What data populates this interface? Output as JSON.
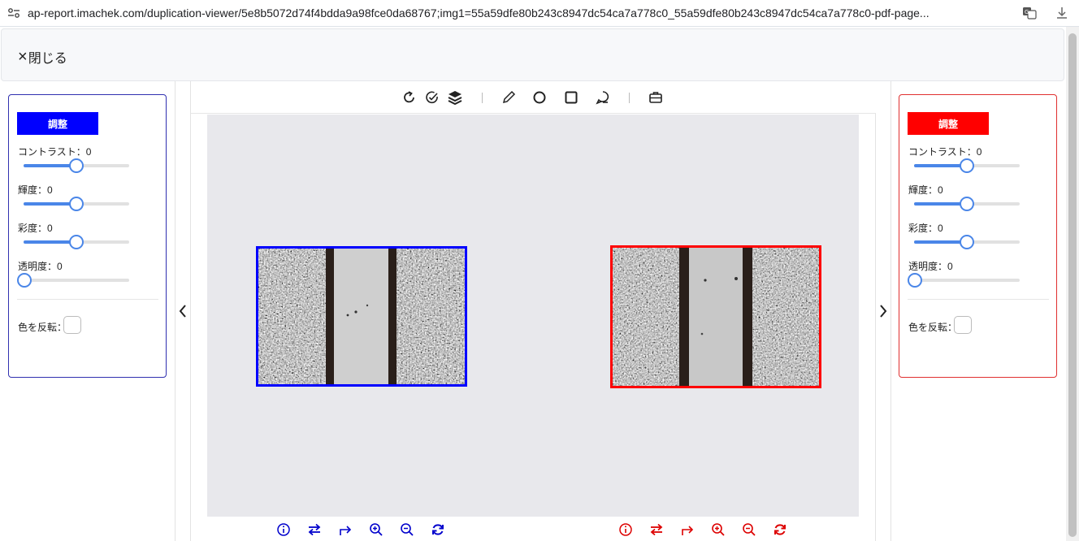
{
  "browser": {
    "url": "ap-report.imachek.com/duplication-viewer/5e8b5072d74f4bdda9a98fce0da68767;img1=55a59dfe80b243c8947dc54ca7a778c0_55a59dfe80b243c8947dc54ca7a778c0-pdf-page..."
  },
  "header": {
    "close_label": "閉じる",
    "close_icon": "×"
  },
  "left_panel": {
    "adjust_label": "調整",
    "accent": "#0000ff",
    "contrast_label": "コントラスト：0",
    "contrast_value": 0,
    "brightness_label": "輝度：0",
    "brightness_value": 0,
    "saturation_label": "彩度：0",
    "saturation_value": 0,
    "opacity_label": "透明度：0",
    "opacity_value": 0,
    "invert_label": "色を反転："
  },
  "right_panel": {
    "adjust_label": "調整",
    "accent": "#ff0000",
    "contrast_label": "コントラスト：0",
    "contrast_value": 0,
    "brightness_label": "輝度：0",
    "brightness_value": 0,
    "saturation_label": "彩度：0",
    "saturation_value": 0,
    "opacity_label": "透明度：0",
    "opacity_value": 0,
    "invert_label": "色を反転："
  },
  "toolbar": {
    "icons": [
      "rotate-icon",
      "check-circle-icon",
      "layers-icon",
      "pencil-icon",
      "circle-icon",
      "square-icon",
      "comment-icon",
      "briefcase-icon"
    ]
  },
  "image_controls": {
    "icons": [
      "info-icon",
      "swap-icon",
      "redo-icon",
      "zoom-in-icon",
      "zoom-out-icon",
      "refresh-icon"
    ],
    "left_color": "#0000cc",
    "right_color": "#dd0000"
  },
  "colors": {
    "slider": "#4a86e8",
    "canvas": "#e8e8ec"
  }
}
